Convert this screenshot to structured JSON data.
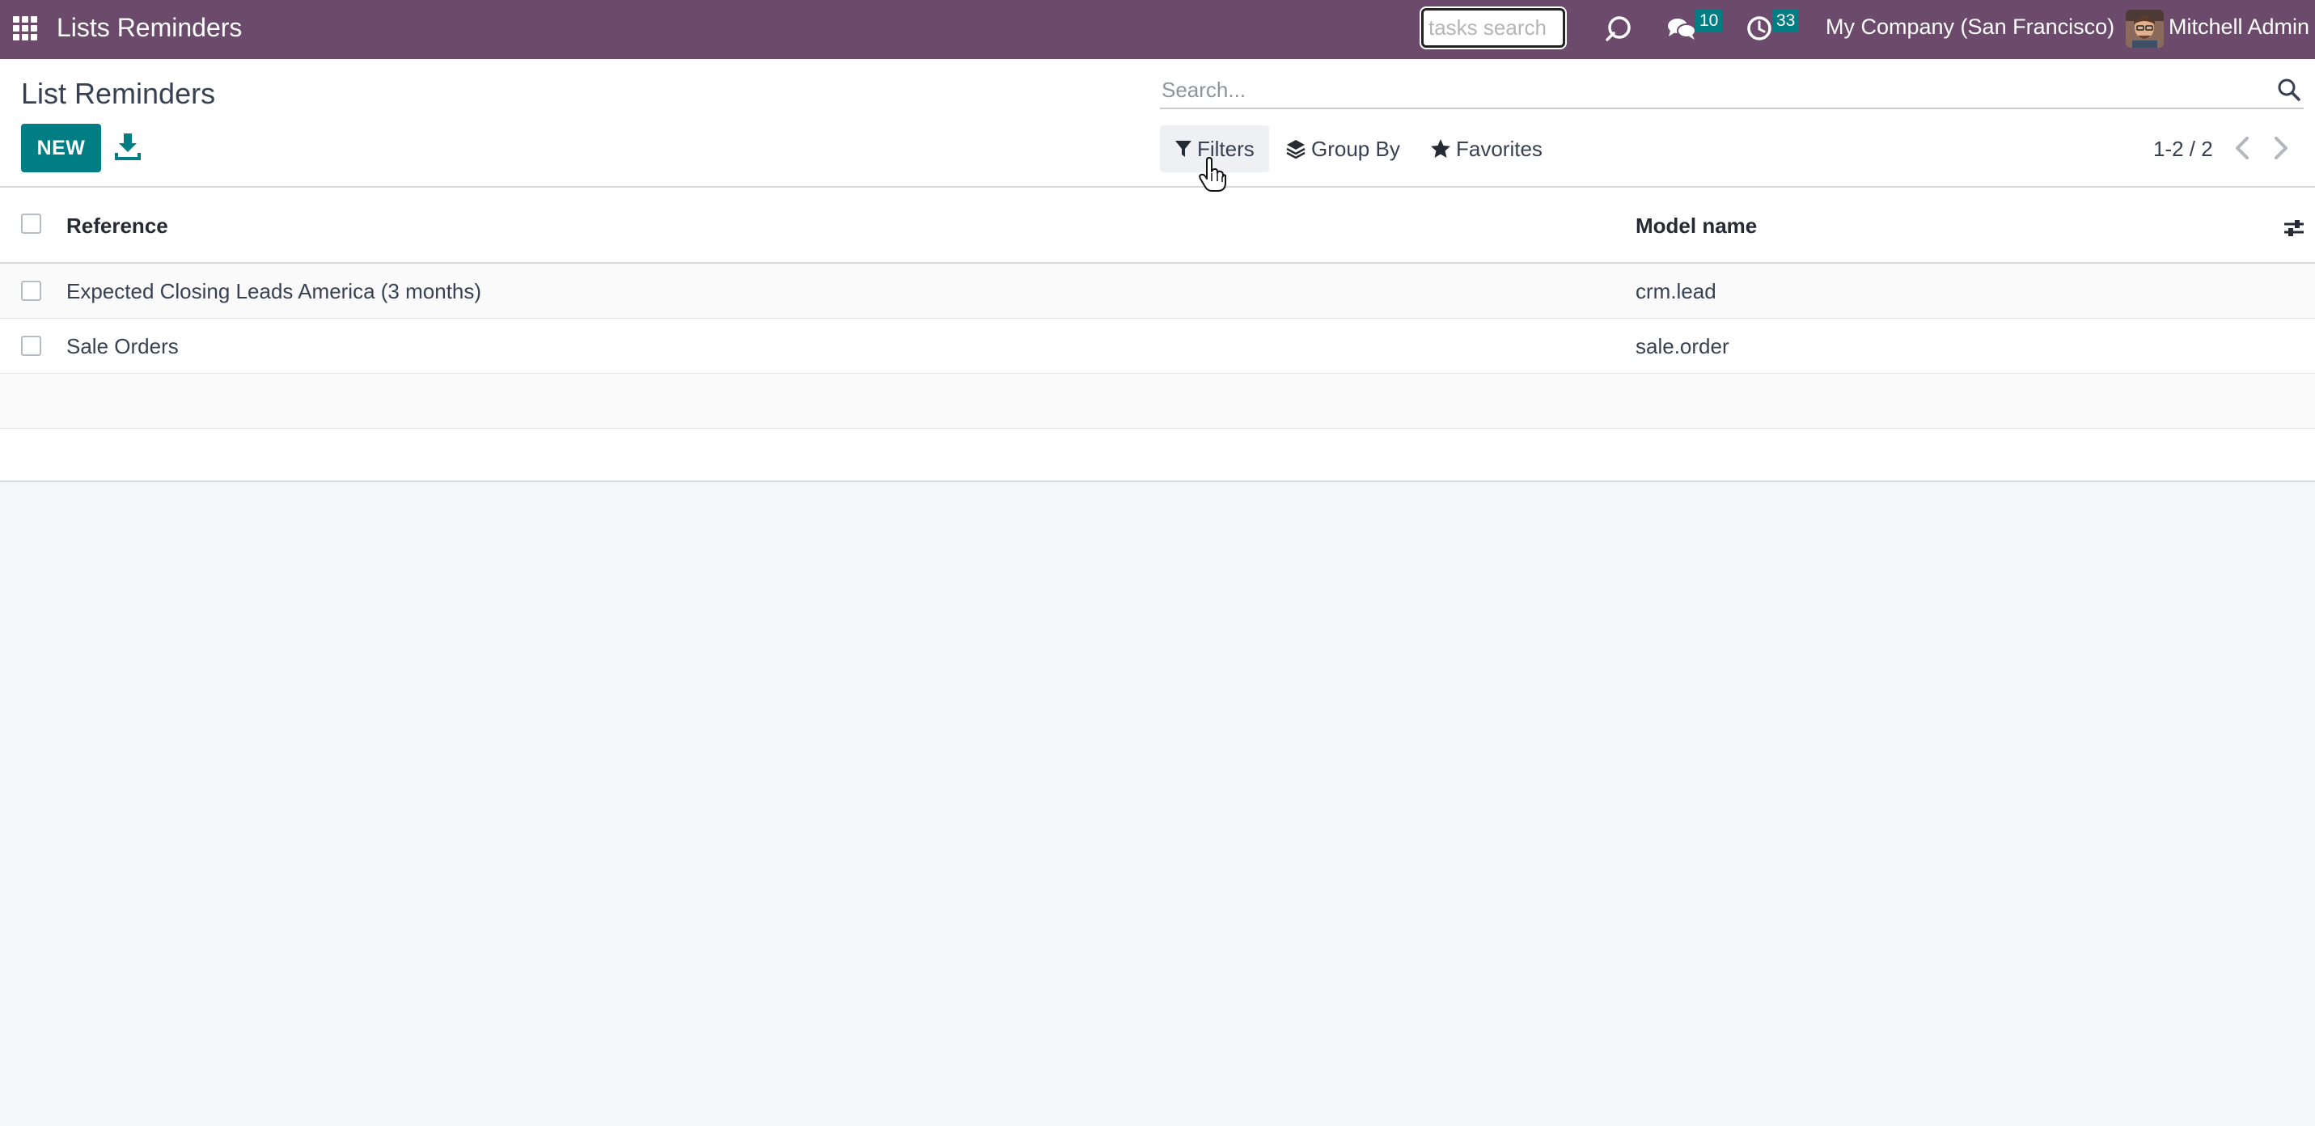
{
  "navbar": {
    "app_title": "Lists Reminders",
    "tasks_search_placeholder": "tasks search",
    "messages_count": "10",
    "activities_count": "33",
    "company": "My Company (San Francisco)",
    "user_name": "Mitchell Admin"
  },
  "control_panel": {
    "title": "List Reminders",
    "new_label": "NEW",
    "search_placeholder": "Search...",
    "filters_label": "Filters",
    "group_by_label": "Group By",
    "favorites_label": "Favorites",
    "pager": "1-2 / 2"
  },
  "list": {
    "columns": [
      "Reference",
      "Model name"
    ],
    "rows": [
      {
        "reference": "Expected Closing Leads America (3 months)",
        "model": "crm.lead"
      },
      {
        "reference": "Sale Orders",
        "model": "sale.order"
      }
    ]
  },
  "colors": {
    "navbar": "#6c4a6c",
    "primary": "#017e84",
    "background": "#f5f6fa"
  },
  "icons": [
    "apps-grid-icon",
    "debug-bug-icon",
    "chat-icon",
    "clock-icon",
    "download-icon",
    "search-icon",
    "filter-icon",
    "layers-icon",
    "star-icon",
    "chevron-left-icon",
    "chevron-right-icon",
    "sliders-icon"
  ]
}
